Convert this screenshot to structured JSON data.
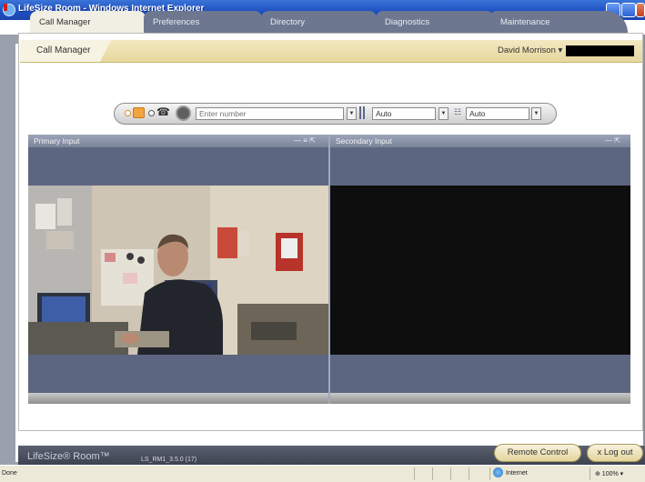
{
  "window": {
    "title": "LifeSize Room - Windows Internet Explorer",
    "icon": "ie-logo-icon"
  },
  "tabs": [
    {
      "label": "Call Manager",
      "active": true
    },
    {
      "label": "Preferences",
      "active": false
    },
    {
      "label": "Directory",
      "active": false
    },
    {
      "label": "Diagnostics",
      "active": false
    },
    {
      "label": "Maintenance",
      "active": false
    }
  ],
  "subheader": {
    "tab_label": "Call Manager",
    "user_name": "David Morrison ▾"
  },
  "dial_toolbar": {
    "number_placeholder": "Enter number",
    "bandwidth_value": "Auto",
    "protocol_value": "Auto",
    "icons": [
      "video-call-icon",
      "phone-icon",
      "directory-icon",
      "bandwidth-icon",
      "network-icon",
      "dropdown-arrow-icon"
    ]
  },
  "panes": {
    "primary": {
      "title": "Primary Input",
      "controls": "— ≡ ⇱"
    },
    "secondary": {
      "title": "Secondary Input",
      "controls": "— ⇱"
    }
  },
  "footer": {
    "logo": "LifeSize® Room™",
    "version": "LS_RM1_3.5.0 (17)",
    "remote_control_label": "Remote Control",
    "logout_label": "x Log out"
  },
  "statusbar": {
    "status": "Done",
    "zone": "Internet",
    "zoom": "⊕ 100% ▾"
  },
  "colors": {
    "title_bar": "#1d4fc0",
    "tab_inactive": "#6d7890",
    "subheader": "#e7d79e",
    "pane": "#5d6680"
  }
}
